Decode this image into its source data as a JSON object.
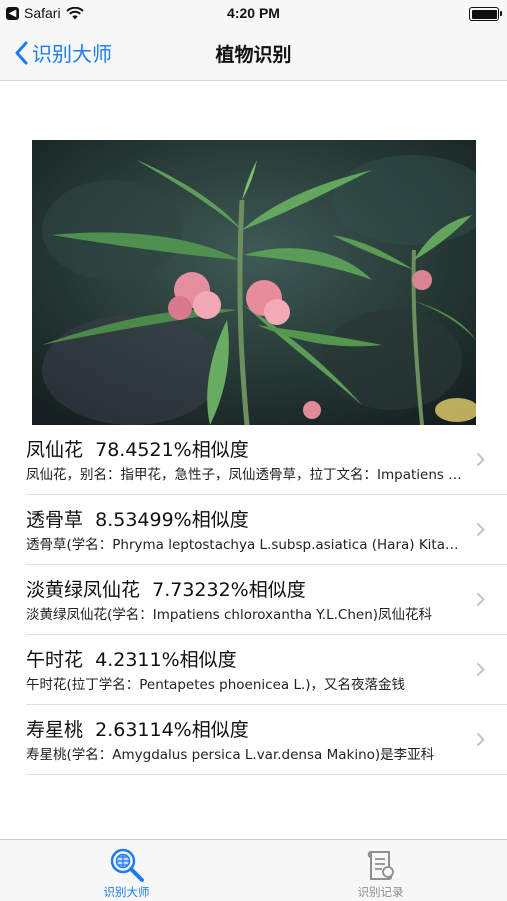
{
  "status": {
    "carrier": "Safari",
    "time": "4:20 PM"
  },
  "nav": {
    "back_label": "识别大师",
    "title": "植物识别"
  },
  "results": [
    {
      "name": "凤仙花",
      "score": "78.4521%相似度",
      "desc": "凤仙花，别名：指甲花，急性子，凤仙透骨草，拉丁文名：Impatiens balsamina"
    },
    {
      "name": "透骨草",
      "score": "8.53499%相似度",
      "desc": "透骨草(学名：Phryma leptostachya L.subsp.asiatica (Hara) Kitamura)"
    },
    {
      "name": "淡黄绿凤仙花",
      "score": "7.73232%相似度",
      "desc": "淡黄绿凤仙花(学名：Impatiens chloroxantha Y.L.Chen)凤仙花科"
    },
    {
      "name": "午时花",
      "score": "4.2311%相似度",
      "desc": "午时花(拉丁学名：Pentapetes phoenicea L.)，又名夜落金钱"
    },
    {
      "name": "寿星桃",
      "score": "2.63114%相似度",
      "desc": "寿星桃(学名：Amygdalus persica L.var.densa Makino)是李亚科"
    }
  ],
  "tabs": [
    {
      "label": "识别大师",
      "icon": "magnifier-globe-icon",
      "active": true,
      "color": "#1a7cf0"
    },
    {
      "label": "识别记录",
      "icon": "scroll-document-icon",
      "active": false,
      "color": "#8e8e93"
    }
  ],
  "colors": {
    "accent": "#1a7cf0",
    "inactive": "#8e8e93"
  }
}
